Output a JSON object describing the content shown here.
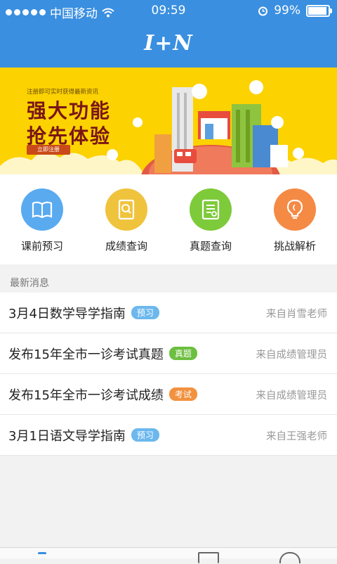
{
  "status_bar": {
    "carrier": "中国移动",
    "time": "09:59",
    "battery": "99%",
    "battery_level": 0.99
  },
  "header": {
    "logo": "I+N"
  },
  "banner": {
    "small_text": "注册即可实时获得最新资讯",
    "line1": "强大功能",
    "line2": "抢先体验",
    "button": "立即注册",
    "colors": {
      "background": "#fcd200",
      "headline": "#7a1616"
    }
  },
  "shortcuts": [
    {
      "label": "课前预习",
      "icon": "book-icon",
      "color": "#5aaaf0"
    },
    {
      "label": "成绩查询",
      "icon": "search-document-icon",
      "color": "#f0c33c"
    },
    {
      "label": "真题查询",
      "icon": "document-list-icon",
      "color": "#7dca3a"
    },
    {
      "label": "挑战解析",
      "icon": "lightbulb-icon",
      "color": "#f58a45"
    }
  ],
  "news": {
    "heading": "最新消息",
    "items": [
      {
        "title": "3月4日数学导学指南",
        "tag": "预习",
        "tag_color": "#6cb8ee",
        "source": "来自肖雪老师"
      },
      {
        "title": "发布15年全市一诊考试真题",
        "tag": "真题",
        "tag_color": "#6cbf3f",
        "source": "来自成绩管理员"
      },
      {
        "title": "发布15年全市一诊考试成绩",
        "tag": "考试",
        "tag_color": "#f2913e",
        "source": "来自成绩管理员"
      },
      {
        "title": "3月1日语文导学指南",
        "tag": "预习",
        "tag_color": "#6cb8ee",
        "source": "来自王强老师"
      }
    ]
  },
  "colors": {
    "accent": "#3a8fe0"
  }
}
